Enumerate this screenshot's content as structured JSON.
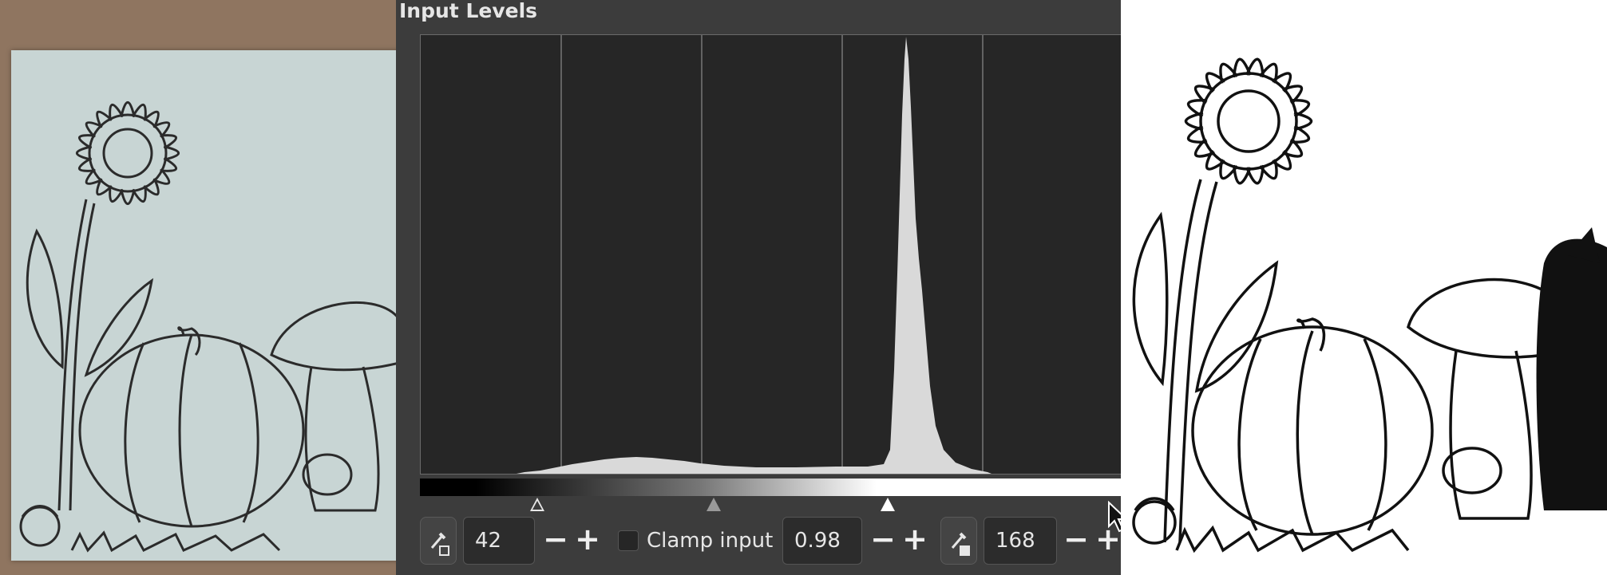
{
  "dialog": {
    "title": "Input Levels",
    "low_input": "42",
    "gamma": "0.98",
    "high_input": "168",
    "clamp_label": "Clamp input",
    "clamp_checked": false,
    "minus": "−",
    "plus": "+"
  },
  "colors": {
    "dialog_bg": "#3c3c3c",
    "histogram_bg": "#262626",
    "histogram_fill": "#d9d9d9",
    "paper": "#c8d5d4",
    "table": "#8f7560"
  },
  "icons": [
    "color-picker-black-icon",
    "color-picker-white-icon",
    "mouse-cursor-icon"
  ]
}
